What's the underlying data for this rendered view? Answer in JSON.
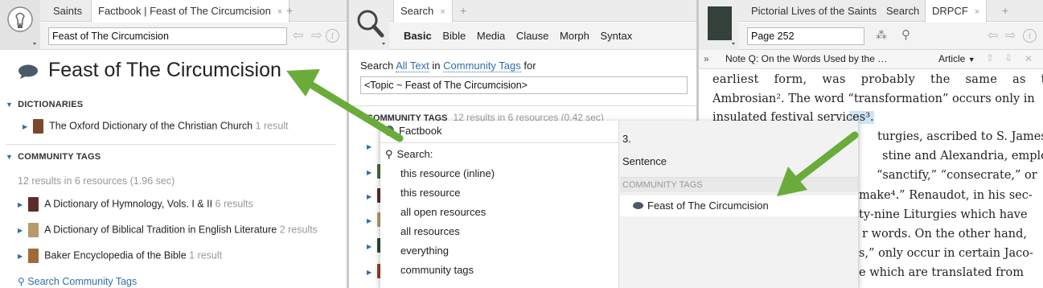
{
  "left_pane": {
    "tabs": [
      "Saints",
      "Factbook | Feast of The Circumcision"
    ],
    "close_glyph": "×",
    "plus_glyph": "+",
    "search_value": "Feast of The Circumcision",
    "title": "Feast of The Circumcision",
    "dictionaries": {
      "header": "DICTIONARIES",
      "item": "The Oxford Dictionary of the Christian Church",
      "count": "1 result"
    },
    "community_tags": {
      "header": "COMMUNITY TAGS",
      "summary": "12 results in 6 resources (1.96 sec)",
      "items": [
        {
          "title": "A Dictionary of Hymnology, Vols. I & II",
          "count": "6 results"
        },
        {
          "title": "A Dictionary of Biblical Tradition in English Literature",
          "count": "2 results"
        },
        {
          "title": "Baker Encyclopedia of the Bible",
          "count": "1 result"
        }
      ],
      "search_link": "Search Community Tags"
    }
  },
  "middle_pane": {
    "tabs": [
      "Search"
    ],
    "search_types": [
      "Basic",
      "Bible",
      "Media",
      "Clause",
      "Morph",
      "Syntax"
    ],
    "scope": {
      "w1": "Search",
      "link1": "All Text",
      "w2": "in",
      "link2": "Community Tags",
      "w3": "for"
    },
    "query": "<Topic ~ Feast of The Circumcision>",
    "results_header": "COMMUNITY TAGS",
    "results_summary": "12 results in 6 resources (0.42 sec)"
  },
  "popup": {
    "factbook": "Factbook",
    "search_label": "Search:",
    "options": [
      "this resource (inline)",
      "this resource",
      "all open resources",
      "all resources",
      "everything",
      "community tags"
    ],
    "right_number": "3.",
    "right_sentence": "Sentence",
    "right_header": "COMMUNITY TAGS",
    "right_tag": "Feast of The Circumcision"
  },
  "right_pane": {
    "tabs": [
      "Pictorial Lives of the Saints",
      "Search",
      "DRPCF"
    ],
    "page_value": "Page 252",
    "note": "Note Q: On the Words Used by the …",
    "article": "Article",
    "lines": [
      "earliest form, was probably the same as the",
      "Ambrosian². The word “transformation” occurs only in",
      "insulated festival services³.",
      "turgies, ascribed to S. James",
      "stine and Alexandria, employ",
      "“sanctify,” “consecrate,” or",
      "make⁴.” Renaudot, in his sec-",
      "ty-nine Liturgies which have",
      "r words. On the other hand,",
      "s,” only occur in certain Jaco-",
      "e which are translated from"
    ]
  },
  "colors": {
    "accent": "#2f6ea8",
    "arrow": "#6aac3a",
    "marker": "#e8742a"
  }
}
